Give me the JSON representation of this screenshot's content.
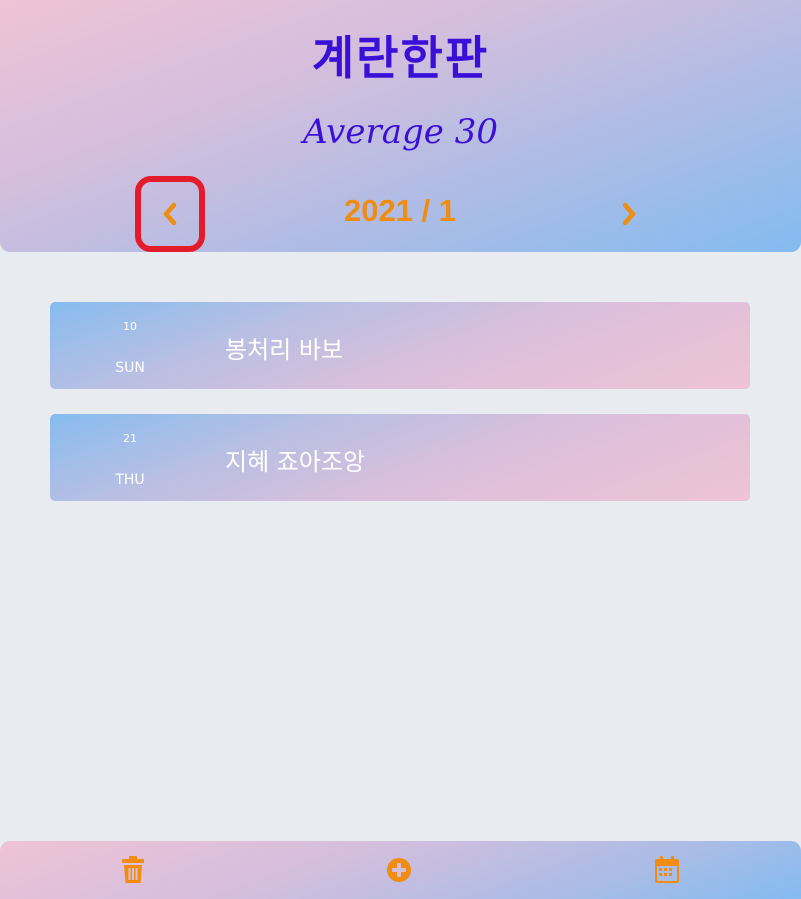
{
  "header": {
    "title": "계란한판",
    "average": "Average 30",
    "month": "2021 / 1",
    "prev_icon": "chevron-left-icon",
    "next_icon": "chevron-right-icon"
  },
  "entries": [
    {
      "day": "10",
      "weekday": "SUN",
      "memo": "봉처리 바보"
    },
    {
      "day": "21",
      "weekday": "THU",
      "memo": "지혜 죠아조앙"
    }
  ],
  "footer": {
    "icons": [
      "trash-icon",
      "plus-circle-icon",
      "calendar-icon"
    ]
  },
  "colors": {
    "accent": "#f08c10",
    "title": "#3a10d8",
    "highlight": "#e41b2a",
    "background": "#e8ebf0"
  }
}
